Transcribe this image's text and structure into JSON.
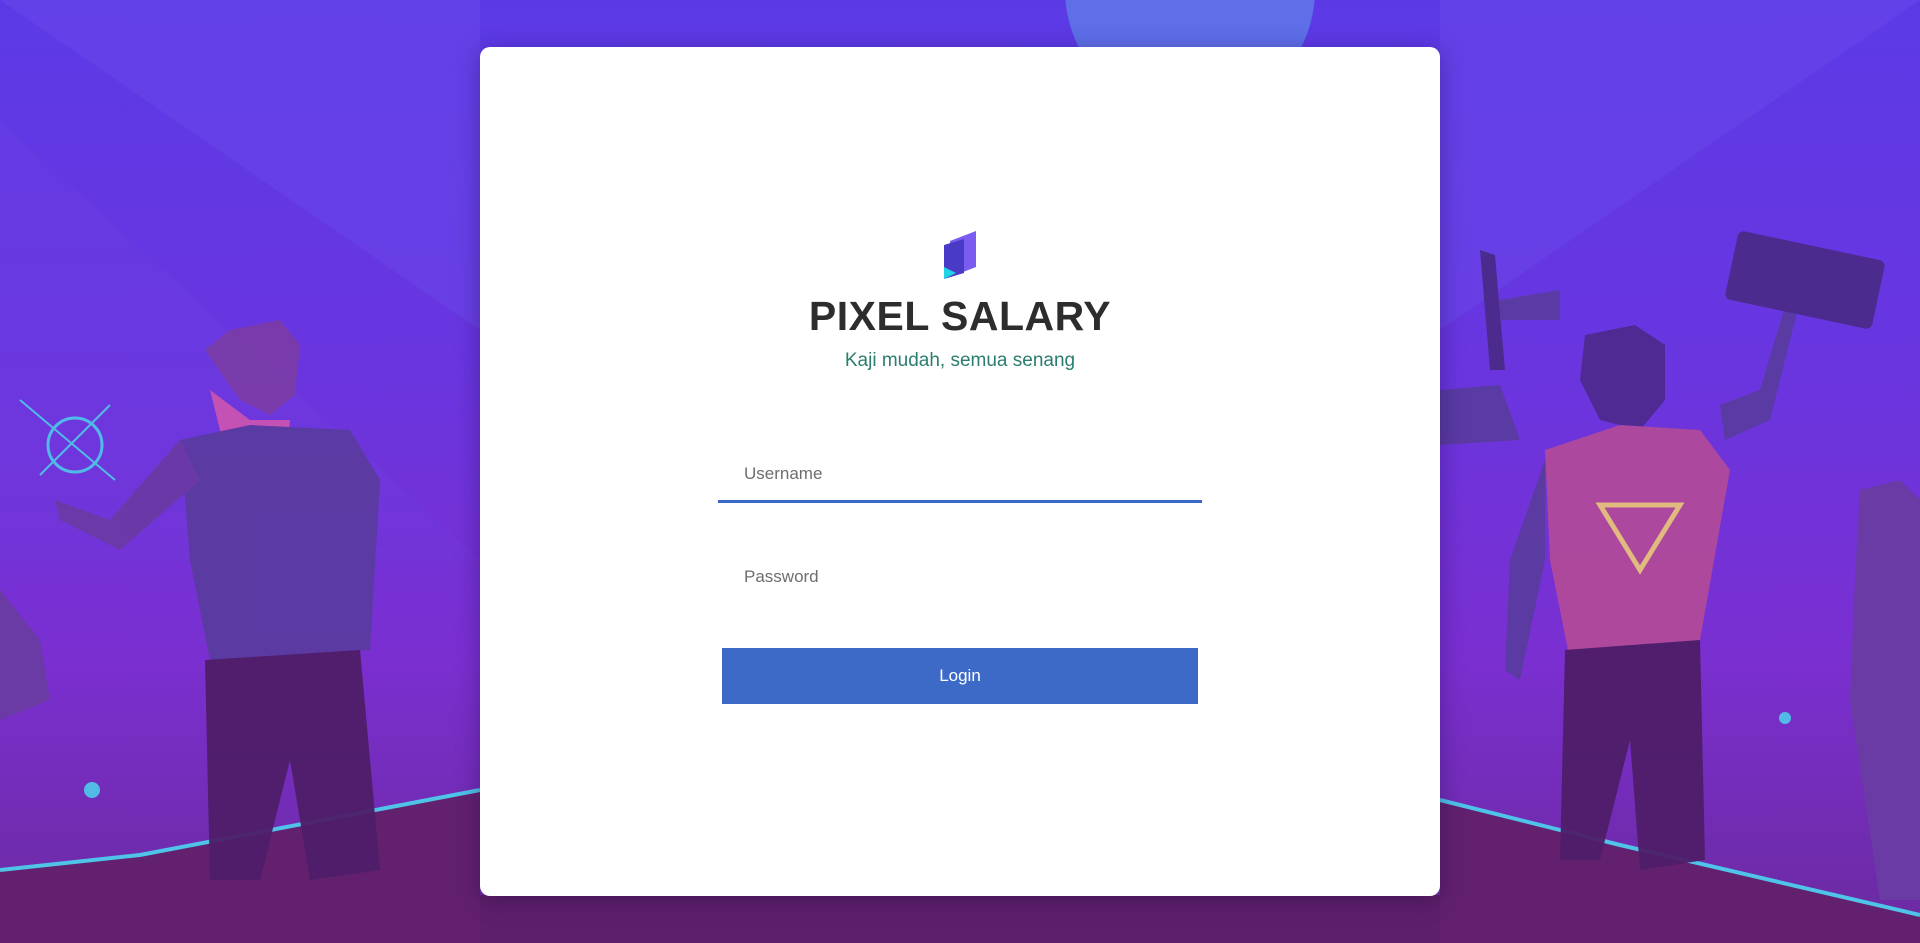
{
  "app": {
    "title": "PIXEL SALARY",
    "tagline": "Kaji mudah, semua senang"
  },
  "login_form": {
    "username": {
      "placeholder": "Username",
      "value": ""
    },
    "password": {
      "placeholder": "Password",
      "value": ""
    },
    "submit_label": "Login"
  },
  "icons": {
    "logo": "pixel-salary-logo-icon"
  },
  "colors": {
    "accent": "#3d6ac7",
    "title_text": "#2d2d2d",
    "tagline_text": "#2a7d6f",
    "background_top": "#5b3ae6",
    "background_bottom": "#6b2a9e",
    "card": "#ffffff"
  }
}
